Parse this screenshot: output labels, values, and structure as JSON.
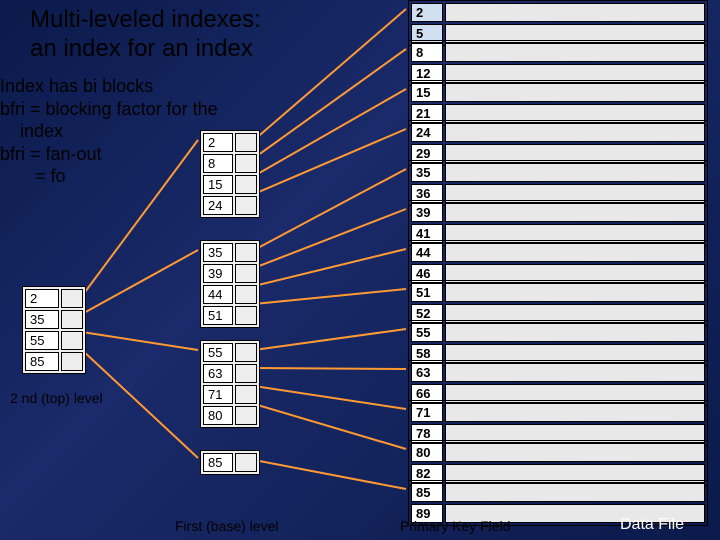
{
  "title_line1": "Multi-leveled indexes:",
  "title_line2": "an index for an index",
  "body_line1": "Index has bi blocks",
  "body_line2": "bfri = blocking factor for the",
  "body_line3": "    index",
  "body_line4": "bfri = fan-out",
  "body_line5": "       = fo",
  "label_top_level": "2 nd (top) level",
  "label_first_level": "First (base) level",
  "label_pk": "Primary Key Field",
  "label_df": "Data File",
  "top_level": [
    "2",
    "35",
    "55",
    "85"
  ],
  "first_level": [
    [
      "2",
      "8",
      "15",
      "24"
    ],
    [
      "35",
      "39",
      "44",
      "51"
    ],
    [
      "55",
      "63",
      "71",
      "80"
    ],
    [
      "85"
    ]
  ],
  "data_file": [
    [
      "2",
      "5"
    ],
    [
      "8",
      "12"
    ],
    [
      "15",
      "21"
    ],
    [
      "24",
      "29"
    ],
    [
      "35",
      "36"
    ],
    [
      "39",
      "41"
    ],
    [
      "44",
      "46"
    ],
    [
      "51",
      "52"
    ],
    [
      "55",
      "58"
    ],
    [
      "63",
      "66"
    ],
    [
      "71",
      "78"
    ],
    [
      "80",
      "82"
    ],
    [
      "85",
      "89"
    ]
  ],
  "colors": {
    "pointer": "#ff9933"
  }
}
